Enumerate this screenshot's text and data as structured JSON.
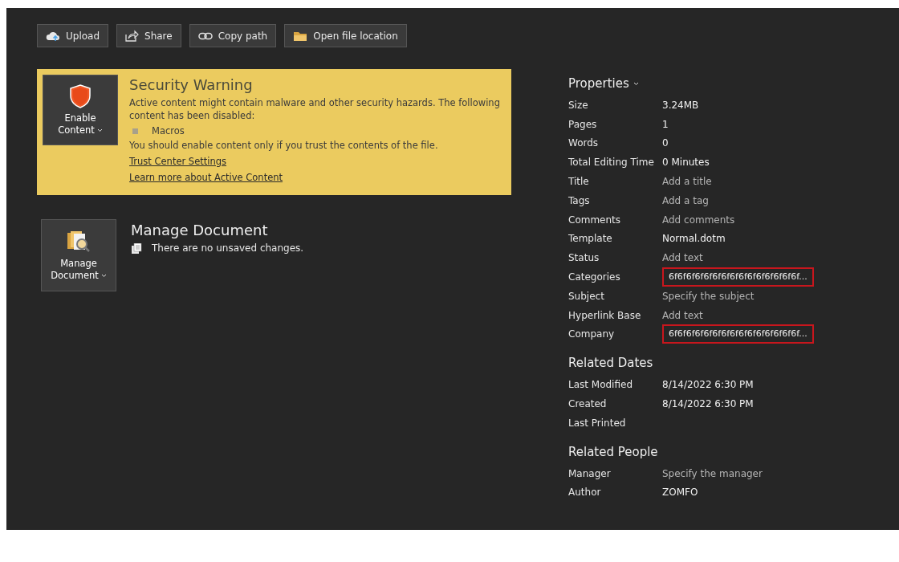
{
  "toolbar": [
    {
      "label": "Upload",
      "kind": "upload"
    },
    {
      "label": "Share",
      "kind": "share"
    },
    {
      "label": "Copy path",
      "kind": "copy"
    },
    {
      "label": "Open file location",
      "kind": "open"
    }
  ],
  "security_warning": {
    "button": {
      "line1": "Enable",
      "line2": "Content"
    },
    "title": "Security Warning",
    "message": "Active content might contain malware and other security hazards. The following content has been disabled:",
    "disabled_items": [
      "Macros"
    ],
    "advice": "You should enable content only if you trust the contents of the file.",
    "links": [
      "Trust Center Settings",
      "Learn more about Active Content"
    ]
  },
  "manage_document": {
    "button": {
      "line1": "Manage",
      "line2": "Document"
    },
    "title": "Manage Document",
    "status": "There are no unsaved changes."
  },
  "properties": {
    "title": "Properties",
    "rows": [
      {
        "label": "Size",
        "value": "3.24MB",
        "hint": false,
        "highlighted": false
      },
      {
        "label": "Pages",
        "value": "1",
        "hint": false,
        "highlighted": false
      },
      {
        "label": "Words",
        "value": "0",
        "hint": false,
        "highlighted": false
      },
      {
        "label": "Total Editing Time",
        "value": "0 Minutes",
        "hint": false,
        "highlighted": false
      },
      {
        "label": "Title",
        "value": "Add a title",
        "hint": true,
        "highlighted": false
      },
      {
        "label": "Tags",
        "value": "Add a tag",
        "hint": true,
        "highlighted": false
      },
      {
        "label": "Comments",
        "value": "Add comments",
        "hint": true,
        "highlighted": false
      },
      {
        "label": "Template",
        "value": "Normal.dotm",
        "hint": false,
        "highlighted": false
      },
      {
        "label": "Status",
        "value": "Add text",
        "hint": true,
        "highlighted": false
      },
      {
        "label": "Categories",
        "value": "6f6f6f6f6f6f6f6f6f6f6f6f6f6f6f...",
        "hint": false,
        "highlighted": true
      },
      {
        "label": "Subject",
        "value": "Specify the subject",
        "hint": true,
        "highlighted": false
      },
      {
        "label": "Hyperlink Base",
        "value": "Add text",
        "hint": true,
        "highlighted": false
      },
      {
        "label": "Company",
        "value": "6f6f6f6f6f6f6f6f6f6f6f6f6f6f6f...",
        "hint": false,
        "highlighted": true
      }
    ]
  },
  "related_dates": {
    "title": "Related Dates",
    "rows": [
      {
        "label": "Last Modified",
        "value": "8/14/2022 6:30 PM"
      },
      {
        "label": "Created",
        "value": "8/14/2022 6:30 PM"
      },
      {
        "label": "Last Printed"
      }
    ]
  },
  "related_people": {
    "title": "Related People",
    "rows": [
      {
        "label": "Manager",
        "value": "Specify the manager",
        "hint": true
      },
      {
        "label": "Author",
        "value": "ZOMFO",
        "hint": false
      }
    ]
  }
}
